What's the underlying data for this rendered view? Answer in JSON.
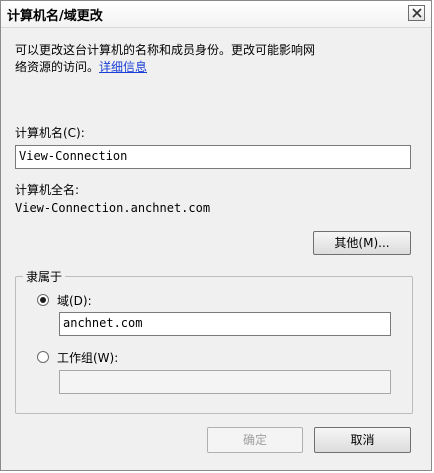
{
  "window": {
    "title": "计算机名/域更改"
  },
  "description": {
    "line1": "可以更改这台计算机的名称和成员身份。更改可能影响网",
    "line2": "络资源的访问。",
    "link": "详细信息"
  },
  "computer_name": {
    "label": "计算机名(C):",
    "value": "View-Connection"
  },
  "full_name": {
    "label": "计算机全名:",
    "value": "View-Connection.anchnet.com"
  },
  "other_button": "其他(M)...",
  "member_of": {
    "label": "隶属于",
    "domain": {
      "label": "域(D):",
      "value": "anchnet.com",
      "selected": true
    },
    "workgroup": {
      "label": "工作组(W):",
      "value": "",
      "selected": false
    }
  },
  "buttons": {
    "ok": "确定",
    "cancel": "取消"
  }
}
